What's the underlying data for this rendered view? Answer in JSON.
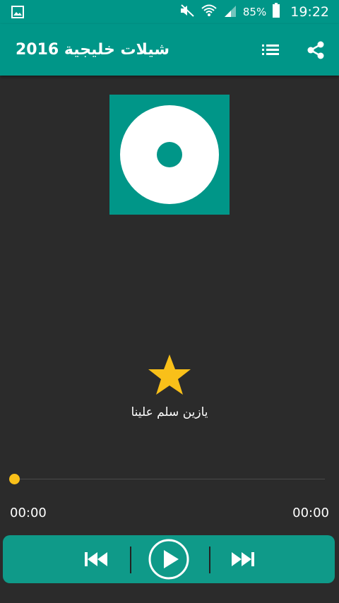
{
  "status_bar": {
    "battery_percent": "85%",
    "time": "19:22",
    "icons": [
      "gallery-icon",
      "mute-icon",
      "wifi-icon",
      "signal-icon",
      "battery-icon"
    ]
  },
  "app_bar": {
    "title": "شيلات خليجية 2016",
    "icons": [
      "playlist-icon",
      "share-icon"
    ]
  },
  "now_playing": {
    "song_title": "يازين سلم علينا",
    "favorite": true,
    "progress": 0
  },
  "player": {
    "current_time": "00:00",
    "total_time": "00:00"
  },
  "colors": {
    "primary": "#009688",
    "background": "#2b2b2b",
    "accent": "#f9c019",
    "text": "#ffffff"
  }
}
